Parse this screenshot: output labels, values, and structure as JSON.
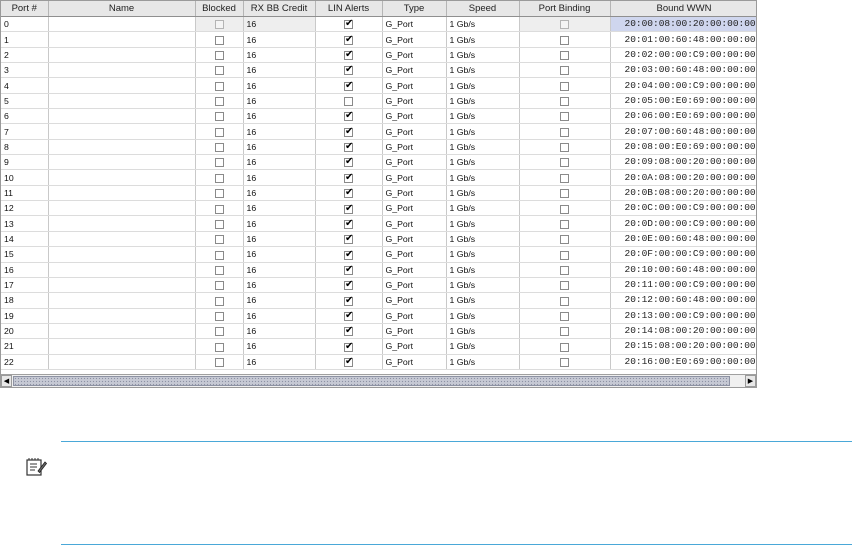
{
  "table": {
    "columns": [
      "Port #",
      "Name",
      "Blocked",
      "RX BB Credit",
      "LIN Alerts",
      "Type",
      "Speed",
      "Port Binding",
      "Bound WWN"
    ],
    "rows": [
      {
        "port": "0",
        "name": "",
        "blocked": false,
        "rx": "16",
        "lin": true,
        "type": "G_Port",
        "speed": "1 Gb/s",
        "binding": false,
        "wwn": "20:00:08:00:20:00:00:00"
      },
      {
        "port": "1",
        "name": "",
        "blocked": false,
        "rx": "16",
        "lin": true,
        "type": "G_Port",
        "speed": "1 Gb/s",
        "binding": false,
        "wwn": "20:01:00:60:48:00:00:00"
      },
      {
        "port": "2",
        "name": "",
        "blocked": false,
        "rx": "16",
        "lin": true,
        "type": "G_Port",
        "speed": "1 Gb/s",
        "binding": false,
        "wwn": "20:02:00:00:C9:00:00:00"
      },
      {
        "port": "3",
        "name": "",
        "blocked": false,
        "rx": "16",
        "lin": true,
        "type": "G_Port",
        "speed": "1 Gb/s",
        "binding": false,
        "wwn": "20:03:00:60:48:00:00:00"
      },
      {
        "port": "4",
        "name": "",
        "blocked": false,
        "rx": "16",
        "lin": true,
        "type": "G_Port",
        "speed": "1 Gb/s",
        "binding": false,
        "wwn": "20:04:00:00:C9:00:00:00"
      },
      {
        "port": "5",
        "name": "",
        "blocked": false,
        "rx": "16",
        "lin": false,
        "type": "G_Port",
        "speed": "1 Gb/s",
        "binding": false,
        "wwn": "20:05:00:E0:69:00:00:00"
      },
      {
        "port": "6",
        "name": "",
        "blocked": false,
        "rx": "16",
        "lin": true,
        "type": "G_Port",
        "speed": "1 Gb/s",
        "binding": false,
        "wwn": "20:06:00:E0:69:00:00:00"
      },
      {
        "port": "7",
        "name": "",
        "blocked": false,
        "rx": "16",
        "lin": true,
        "type": "G_Port",
        "speed": "1 Gb/s",
        "binding": false,
        "wwn": "20:07:00:60:48:00:00:00"
      },
      {
        "port": "8",
        "name": "",
        "blocked": false,
        "rx": "16",
        "lin": true,
        "type": "G_Port",
        "speed": "1 Gb/s",
        "binding": false,
        "wwn": "20:08:00:E0:69:00:00:00"
      },
      {
        "port": "9",
        "name": "",
        "blocked": false,
        "rx": "16",
        "lin": true,
        "type": "G_Port",
        "speed": "1 Gb/s",
        "binding": false,
        "wwn": "20:09:08:00:20:00:00:00"
      },
      {
        "port": "10",
        "name": "",
        "blocked": false,
        "rx": "16",
        "lin": true,
        "type": "G_Port",
        "speed": "1 Gb/s",
        "binding": false,
        "wwn": "20:0A:08:00:20:00:00:00"
      },
      {
        "port": "11",
        "name": "",
        "blocked": false,
        "rx": "16",
        "lin": true,
        "type": "G_Port",
        "speed": "1 Gb/s",
        "binding": false,
        "wwn": "20:0B:08:00:20:00:00:00"
      },
      {
        "port": "12",
        "name": "",
        "blocked": false,
        "rx": "16",
        "lin": true,
        "type": "G_Port",
        "speed": "1 Gb/s",
        "binding": false,
        "wwn": "20:0C:00:00:C9:00:00:00"
      },
      {
        "port": "13",
        "name": "",
        "blocked": false,
        "rx": "16",
        "lin": true,
        "type": "G_Port",
        "speed": "1 Gb/s",
        "binding": false,
        "wwn": "20:0D:00:00:C9:00:00:00"
      },
      {
        "port": "14",
        "name": "",
        "blocked": false,
        "rx": "16",
        "lin": true,
        "type": "G_Port",
        "speed": "1 Gb/s",
        "binding": false,
        "wwn": "20:0E:00:60:48:00:00:00"
      },
      {
        "port": "15",
        "name": "",
        "blocked": false,
        "rx": "16",
        "lin": true,
        "type": "G_Port",
        "speed": "1 Gb/s",
        "binding": false,
        "wwn": "20:0F:00:00:C9:00:00:00"
      },
      {
        "port": "16",
        "name": "",
        "blocked": false,
        "rx": "16",
        "lin": true,
        "type": "G_Port",
        "speed": "1 Gb/s",
        "binding": false,
        "wwn": "20:10:00:60:48:00:00:00"
      },
      {
        "port": "17",
        "name": "",
        "blocked": false,
        "rx": "16",
        "lin": true,
        "type": "G_Port",
        "speed": "1 Gb/s",
        "binding": false,
        "wwn": "20:11:00:00:C9:00:00:00"
      },
      {
        "port": "18",
        "name": "",
        "blocked": false,
        "rx": "16",
        "lin": true,
        "type": "G_Port",
        "speed": "1 Gb/s",
        "binding": false,
        "wwn": "20:12:00:60:48:00:00:00"
      },
      {
        "port": "19",
        "name": "",
        "blocked": false,
        "rx": "16",
        "lin": true,
        "type": "G_Port",
        "speed": "1 Gb/s",
        "binding": false,
        "wwn": "20:13:00:00:C9:00:00:00"
      },
      {
        "port": "20",
        "name": "",
        "blocked": false,
        "rx": "16",
        "lin": true,
        "type": "G_Port",
        "speed": "1 Gb/s",
        "binding": false,
        "wwn": "20:14:08:00:20:00:00:00"
      },
      {
        "port": "21",
        "name": "",
        "blocked": false,
        "rx": "16",
        "lin": true,
        "type": "G_Port",
        "speed": "1 Gb/s",
        "binding": false,
        "wwn": "20:15:08:00:20:00:00:00"
      },
      {
        "port": "22",
        "name": "",
        "blocked": false,
        "rx": "16",
        "lin": true,
        "type": "G_Port",
        "speed": "1 Gb/s",
        "binding": false,
        "wwn": "20:16:00:E0:69:00:00:00"
      }
    ]
  },
  "scrollbar": {
    "left_arrow": "◀",
    "right_arrow": "▶"
  },
  "note": {
    "icon": "note-pad-icon",
    "rule_color": "#4aa8d8"
  },
  "colors": {
    "selected_cell": "#cfd6ee",
    "header_bg": "#e7e7e7"
  }
}
